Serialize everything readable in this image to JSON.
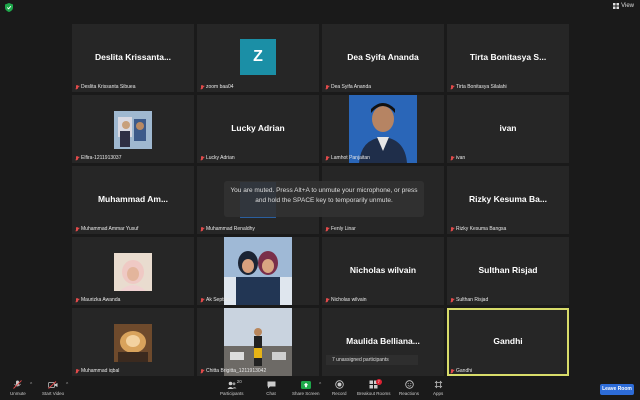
{
  "topbar": {
    "view_label": "View"
  },
  "tiles": [
    {
      "big": "Deslita  Krissanta...",
      "label": "Deslita Krissanta Sibuea"
    },
    {
      "big": "",
      "label": "zoom baa04",
      "avatar": "Z"
    },
    {
      "big": "Dea Syifa Ananda",
      "label": "Dea Syifa Ananda"
    },
    {
      "big": "Tirta Bonitasya S...",
      "label": "Tirta Bonitasya Silalahi"
    },
    {
      "big": "",
      "label": "Elfira-1211913037"
    },
    {
      "big": "Lucky Adrian",
      "label": "Lucky Adrian"
    },
    {
      "big": "",
      "label": "Lamhot Panjaitan"
    },
    {
      "big": "ivan",
      "label": "ivan"
    },
    {
      "big": "Muhammad  Am...",
      "label": "Muhammad Ammar Yusuf"
    },
    {
      "big": "",
      "label": "Muhammad Renaldhy"
    },
    {
      "big": "",
      "label": "Fenly Linar"
    },
    {
      "big": "Rizky Kesuma Ba...",
      "label": "Rizky Kesuma Bangsa"
    },
    {
      "big": "",
      "label": "Maurizka Awanda"
    },
    {
      "big": "",
      "label": "Ak Septiana"
    },
    {
      "big": "Nicholas wilvain",
      "label": "Nicholas wilvain"
    },
    {
      "big": "Sulthan Risjad",
      "label": "Sulthan Risjad"
    },
    {
      "big": "",
      "label": "Muhammad iqbal"
    },
    {
      "big": "",
      "label": "Chitta Brigitta_1211913042"
    },
    {
      "big": "Maulida  Belliana...",
      "label": ""
    },
    {
      "big": "Gandhi",
      "label": "Gandhi"
    }
  ],
  "toast": {
    "text": "You are muted. Press Alt+A to unmute your microphone, or press and hold the SPACE key to temporarily unmute."
  },
  "unassigned": "7 unassigned participants",
  "toolbar": {
    "unmute": "Unmute",
    "start_video": "Start Video",
    "participants": "Participants",
    "participants_count": "20",
    "chat": "Chat",
    "share_screen": "Share Screen",
    "record": "Record",
    "breakout_rooms": "Breakout Rooms",
    "breakout_badge": "7",
    "reactions": "Reactions",
    "apps": "Apps",
    "leave": "Leave Room"
  },
  "colors": {
    "active_border": "#d8dc6a",
    "share_green": "#1ea84b",
    "leave_blue": "#2d6cd8",
    "avatar_teal": "#1b8fa6",
    "mute_red": "#e24b4b"
  }
}
